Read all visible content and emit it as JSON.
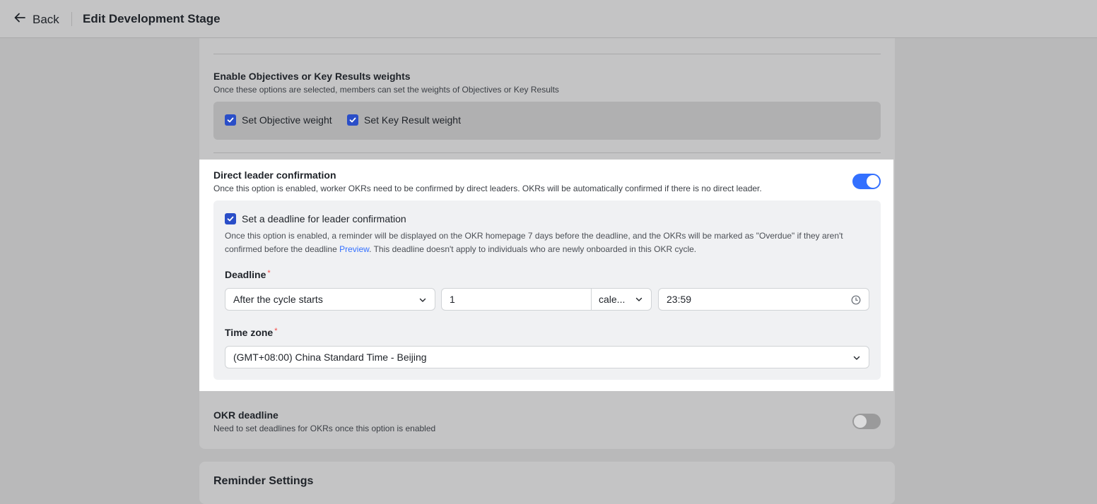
{
  "header": {
    "back_label": "Back",
    "title": "Edit Development Stage"
  },
  "weights": {
    "title": "Enable Objectives or Key Results weights",
    "desc": "Once these options are selected, members can set the weights of Objectives or Key Results",
    "objective_label": "Set Objective weight",
    "objective_checked": true,
    "kr_label": "Set Key Result weight",
    "kr_checked": true
  },
  "leader": {
    "title": "Direct leader confirmation",
    "desc": "Once this option is enabled, worker OKRs need to be confirmed by direct leaders. OKRs will be automatically confirmed if there is no direct leader.",
    "enabled": true,
    "deadline_checkbox_label": "Set a deadline for leader confirmation",
    "deadline_desc_before": "Once this option is enabled, a reminder will be displayed on the OKR homepage 7 days before the deadline, and the OKRs will be marked as \"Overdue\" if they aren't confirmed before the deadline ",
    "preview_link": "Preview",
    "deadline_desc_after": ". This deadline doesn't apply to individuals who are newly onboarded in this OKR cycle.",
    "deadline_label": "Deadline",
    "required_mark": "*",
    "anchor_value": "After the cycle starts",
    "amount_value": "1",
    "unit_value": "cale...",
    "time_value": "23:59",
    "timezone_label": "Time zone",
    "timezone_value": "(GMT+08:00) China Standard Time - Beijing"
  },
  "okr_deadline": {
    "title": "OKR deadline",
    "desc": "Need to set deadlines for OKRs once this option is enabled",
    "enabled": false
  },
  "reminder": {
    "title": "Reminder Settings"
  },
  "colors": {
    "accent": "#3370ff",
    "checkbox": "#2a4ec8",
    "required": "#f54a45"
  }
}
